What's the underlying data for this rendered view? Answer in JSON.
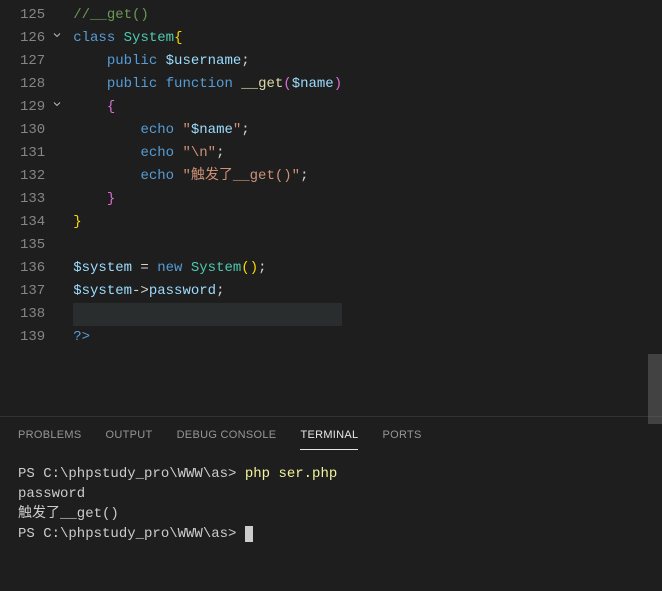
{
  "editor": {
    "lines": [
      {
        "num": 125,
        "fold": "",
        "tokens": [
          [
            "//__get()",
            "c-comment"
          ]
        ]
      },
      {
        "num": 126,
        "fold": "v",
        "tokens": [
          [
            "class ",
            "c-keyword"
          ],
          [
            "System",
            "c-class"
          ],
          [
            "{",
            "c-brace"
          ]
        ]
      },
      {
        "num": 127,
        "fold": "",
        "tokens": [
          [
            "    ",
            ""
          ],
          [
            "public ",
            "c-keyword"
          ],
          [
            "$username",
            "c-var"
          ],
          [
            ";",
            "c-punc"
          ]
        ]
      },
      {
        "num": 128,
        "fold": "",
        "tokens": [
          [
            "    ",
            ""
          ],
          [
            "public ",
            "c-keyword"
          ],
          [
            "function ",
            "c-keyword"
          ],
          [
            "__get",
            "c-func"
          ],
          [
            "(",
            "c-brace2"
          ],
          [
            "$name",
            "c-var"
          ],
          [
            ")",
            "c-brace2"
          ]
        ]
      },
      {
        "num": 129,
        "fold": "v",
        "tokens": [
          [
            "    ",
            ""
          ],
          [
            "{",
            "c-brace2"
          ]
        ]
      },
      {
        "num": 130,
        "fold": "",
        "tokens": [
          [
            "        ",
            ""
          ],
          [
            "echo ",
            "c-keyword"
          ],
          [
            "\"",
            "c-string"
          ],
          [
            "$name",
            "c-var"
          ],
          [
            "\"",
            "c-string"
          ],
          [
            ";",
            "c-punc"
          ]
        ]
      },
      {
        "num": 131,
        "fold": "",
        "tokens": [
          [
            "        ",
            ""
          ],
          [
            "echo ",
            "c-keyword"
          ],
          [
            "\"\\n\"",
            "c-string"
          ],
          [
            ";",
            "c-punc"
          ]
        ]
      },
      {
        "num": 132,
        "fold": "",
        "tokens": [
          [
            "        ",
            ""
          ],
          [
            "echo ",
            "c-keyword"
          ],
          [
            "\"触发了__get()\"",
            "c-string"
          ],
          [
            ";",
            "c-punc"
          ]
        ]
      },
      {
        "num": 133,
        "fold": "",
        "tokens": [
          [
            "    ",
            ""
          ],
          [
            "}",
            "c-brace2"
          ]
        ]
      },
      {
        "num": 134,
        "fold": "",
        "tokens": [
          [
            "}",
            "c-brace"
          ]
        ]
      },
      {
        "num": 135,
        "fold": "",
        "tokens": [
          [
            "",
            ""
          ]
        ]
      },
      {
        "num": 136,
        "fold": "",
        "tokens": [
          [
            "$system",
            "c-var"
          ],
          [
            " = ",
            "c-punc"
          ],
          [
            "new ",
            "c-keyword"
          ],
          [
            "System",
            "c-class"
          ],
          [
            "(",
            "c-brace"
          ],
          [
            ")",
            "c-brace"
          ],
          [
            ";",
            "c-punc"
          ]
        ]
      },
      {
        "num": 137,
        "fold": "",
        "tokens": [
          [
            "$system",
            "c-var"
          ],
          [
            "->",
            "c-punc"
          ],
          [
            "password",
            "c-var"
          ],
          [
            ";",
            "c-punc"
          ]
        ]
      },
      {
        "num": 138,
        "fold": "",
        "tokens": [
          [
            "",
            ""
          ]
        ],
        "current": true
      },
      {
        "num": 139,
        "fold": "",
        "tokens": [
          [
            "?>",
            "c-tag"
          ]
        ]
      }
    ]
  },
  "panel": {
    "tabs": {
      "problems": "PROBLEMS",
      "output": "OUTPUT",
      "debug": "DEBUG CONSOLE",
      "terminal": "TERMINAL",
      "ports": "PORTS"
    },
    "terminal": {
      "prompt1": "PS C:\\phpstudy_pro\\WWW\\as> ",
      "cmd1": "php ser.php",
      "out1": "password",
      "out2": "触发了__get()",
      "prompt2": "PS C:\\phpstudy_pro\\WWW\\as> "
    }
  }
}
